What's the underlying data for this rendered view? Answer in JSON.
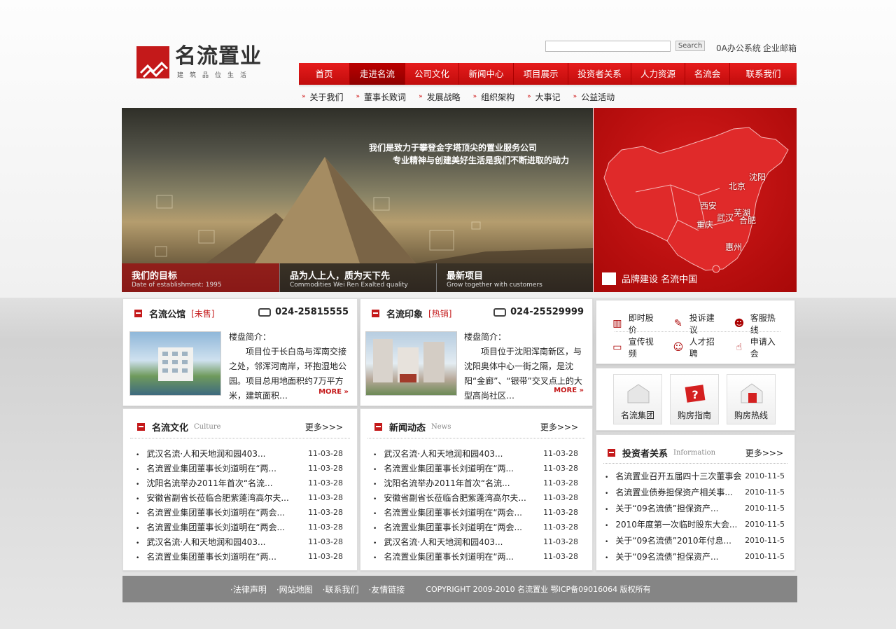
{
  "brand": {
    "name": "名流置业",
    "tagline": "建筑品位生活"
  },
  "search": {
    "placeholder": "",
    "button": "Search"
  },
  "top_links": [
    "0A办公系统",
    "企业邮箱"
  ],
  "nav": [
    "首页",
    "走进名流",
    "公司文化",
    "新闻中心",
    "项目展示",
    "投资者关系",
    "人力资源",
    "名流会",
    "联系我们"
  ],
  "subnav": [
    "关于我们",
    "董事长致词",
    "发展战略",
    "组织架构",
    "大事记",
    "公益活动"
  ],
  "banner": {
    "slogan1": "我们是致力于攀登金字塔顶尖的置业服务公司",
    "slogan2": "专业精神与创建美好生活是我们不断进取的动力",
    "tabs": [
      {
        "title": "我们的目标",
        "sub": "Date of establishment: 1995"
      },
      {
        "title": "品为人上人，质为天下先",
        "sub": "Commodities Wei Ren Exalted quality"
      },
      {
        "title": "最新项目",
        "sub": "Grow together with customers"
      }
    ]
  },
  "map": {
    "cities": [
      "沈阳",
      "北京",
      "西安",
      "芜湖",
      "武汉",
      "合肥",
      "重庆",
      "惠州"
    ],
    "footer": "品牌建设 名流中国"
  },
  "projects": [
    {
      "name": "名流公馆",
      "tag": "[未售]",
      "phone": "024-25815555",
      "intro_label": "楼盘简介：",
      "intro": "项目位于长白岛与浑南交接之处，邻浑河南岸，环抱湿地公园。项目总用地面积约7万平方米，建筑面积…",
      "more": "MORE"
    },
    {
      "name": "名流印象",
      "tag": "[热销]",
      "phone": "024-25529999",
      "intro_label": "楼盘简介：",
      "intro": "项目位于沈阳浑南新区，与沈阳奥体中心一街之隔，是沈阳“金廊”、“银带”交叉点上的大型高尚社区…",
      "more": "MORE"
    }
  ],
  "culture": {
    "title": "名流文化",
    "en": "Culture",
    "more": "更多>>>",
    "items": [
      {
        "title": "武汉名流·人和天地润和园403...",
        "date": "11-03-28"
      },
      {
        "title": "名流置业集团董事长刘道明在“两...",
        "date": "11-03-28"
      },
      {
        "title": "沈阳名流举办2011年首次“名流...",
        "date": "11-03-28"
      },
      {
        "title": "安徽省副省长莅临合肥紫蓬湾高尔夫...",
        "date": "11-03-28"
      },
      {
        "title": "名流置业集团董事长刘道明在“两会...",
        "date": "11-03-28"
      },
      {
        "title": "名流置业集团董事长刘道明在“两会...",
        "date": "11-03-28"
      },
      {
        "title": "武汉名流·人和天地润和园403...",
        "date": "11-03-28"
      },
      {
        "title": "名流置业集团董事长刘道明在“两...",
        "date": "11-03-28"
      }
    ]
  },
  "news": {
    "title": "新闻动态",
    "en": "News",
    "more": "更多>>>",
    "items": [
      {
        "title": "武汉名流·人和天地润和园403...",
        "date": "11-03-28"
      },
      {
        "title": "名流置业集团董事长刘道明在“两...",
        "date": "11-03-28"
      },
      {
        "title": "沈阳名流举办2011年首次“名流...",
        "date": "11-03-28"
      },
      {
        "title": "安徽省副省长莅临合肥紫蓬湾高尔夫...",
        "date": "11-03-28"
      },
      {
        "title": "名流置业集团董事长刘道明在“两会...",
        "date": "11-03-28"
      },
      {
        "title": "名流置业集团董事长刘道明在“两会...",
        "date": "11-03-28"
      },
      {
        "title": "武汉名流·人和天地润和园403...",
        "date": "11-03-28"
      },
      {
        "title": "名流置业集团董事长刘道明在“两...",
        "date": "11-03-28"
      }
    ]
  },
  "services": [
    {
      "label": "即时股价",
      "icon": "building-icon"
    },
    {
      "label": "投诉建议",
      "icon": "pen-icon"
    },
    {
      "label": "客服热线",
      "icon": "people-icon"
    },
    {
      "label": "宣传视频",
      "icon": "tv-icon"
    },
    {
      "label": "人才招聘",
      "icon": "group-icon"
    },
    {
      "label": "申请入会",
      "icon": "hand-icon"
    }
  ],
  "quick": [
    {
      "label": "名流集团",
      "icon": "house-icon"
    },
    {
      "label": "购房指南",
      "icon": "question-icon"
    },
    {
      "label": "购房热线",
      "icon": "home-icon"
    }
  ],
  "investor": {
    "title": "投资者关系",
    "en": "Information",
    "more": "更多>>>",
    "items": [
      {
        "title": "名流置业召开五届四十三次董事会",
        "date": "2010-11-5"
      },
      {
        "title": "名流置业债券担保资产相关事...",
        "date": "2010-11-5"
      },
      {
        "title": "关于“09名流债”担保资产...",
        "date": "2010-11-5"
      },
      {
        "title": "2010年度第一次临时股东大会...",
        "date": "2010-11-5"
      },
      {
        "title": "关于“09名流债”2010年付息...",
        "date": "2010-11-5"
      },
      {
        "title": "关于“09名流债”担保资产...",
        "date": "2010-11-5"
      }
    ]
  },
  "footer": {
    "links": [
      "·法律声明",
      "·网站地图",
      "·联系我们",
      "·友情链接"
    ],
    "copyright": "COPYRIGHT 2009-2010 名流置业 鄂ICP备09016064 版权所有"
  },
  "colors": {
    "brand_red": "#c4191a",
    "footer_gray": "#858585"
  }
}
